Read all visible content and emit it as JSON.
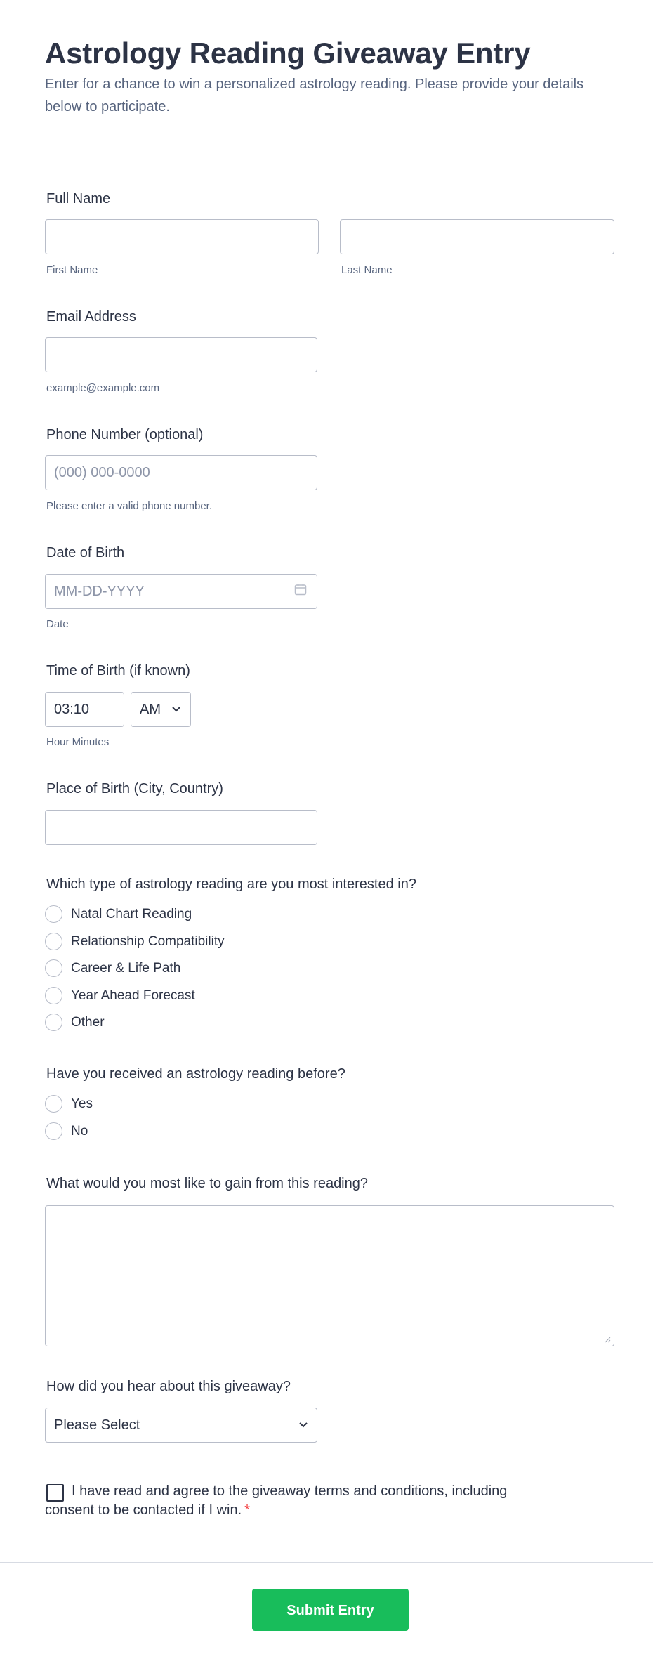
{
  "form": {
    "title": "Astrology Reading Giveaway Entry",
    "subtitle": "Enter for a chance to win a personalized astrology reading. Please provide your details below to participate."
  },
  "full_name": {
    "label": "Full Name",
    "first_sublabel": "First Name",
    "last_sublabel": "Last Name",
    "first_value": "",
    "last_value": ""
  },
  "email": {
    "label": "Email Address",
    "value": "",
    "sublabel": "example@example.com"
  },
  "phone": {
    "label": "Phone Number (optional)",
    "placeholder": "(000) 000-0000",
    "sublabel": "Please enter a valid phone number."
  },
  "dob": {
    "label": "Date of Birth",
    "placeholder": "MM-DD-YYYY",
    "sublabel": "Date",
    "icon": "calendar-icon"
  },
  "tob": {
    "label": "Time of Birth (if known)",
    "time_value": "03:10",
    "ampm_value": "AM",
    "sublabel": "Hour Minutes"
  },
  "pob": {
    "label": "Place of Birth (City, Country)",
    "value": ""
  },
  "reading_type": {
    "label": "Which type of astrology reading are you most interested in?",
    "options": [
      "Natal Chart Reading",
      "Relationship Compatibility",
      "Career & Life Path",
      "Year Ahead Forecast",
      "Other"
    ]
  },
  "previous_reading": {
    "label": "Have you received an astrology reading before?",
    "options": [
      "Yes",
      "No"
    ]
  },
  "gain": {
    "label": "What would you most like to gain from this reading?",
    "value": ""
  },
  "referral": {
    "label": "How did you hear about this giveaway?",
    "selected": "Please Select"
  },
  "consent": {
    "text": "I have read and agree to the giveaway terms and conditions, including consent to be contacted if I win.",
    "required_mark": "*",
    "checked": false
  },
  "submit": {
    "label": "Submit Entry",
    "color": "#18bd5b"
  }
}
